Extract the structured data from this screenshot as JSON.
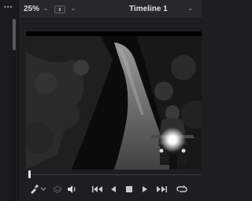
{
  "left_panel": {
    "menu_icon": "more-dots-icon"
  },
  "toolbar": {
    "zoom": "25%",
    "zoom_chevron": "⌄",
    "view_chevron": "⌄",
    "timeline_title": "Timeline 1",
    "timeline_chevron": "⌄"
  },
  "viewer": {
    "scene": "Black-and-white night shot of a motorcyclist riding on a forest road with headlight on"
  },
  "transport": {
    "icons": [
      "eyedropper-icon",
      "chevron-down-icon",
      "layers-icon",
      "volume-icon",
      "jump-to-start-icon",
      "play-reverse-icon",
      "stop-icon",
      "play-icon",
      "jump-to-end-icon",
      "loop-icon"
    ]
  },
  "colors": {
    "panel": "#1e1e20",
    "toolbar": "#28282b",
    "frame": "#000000"
  }
}
